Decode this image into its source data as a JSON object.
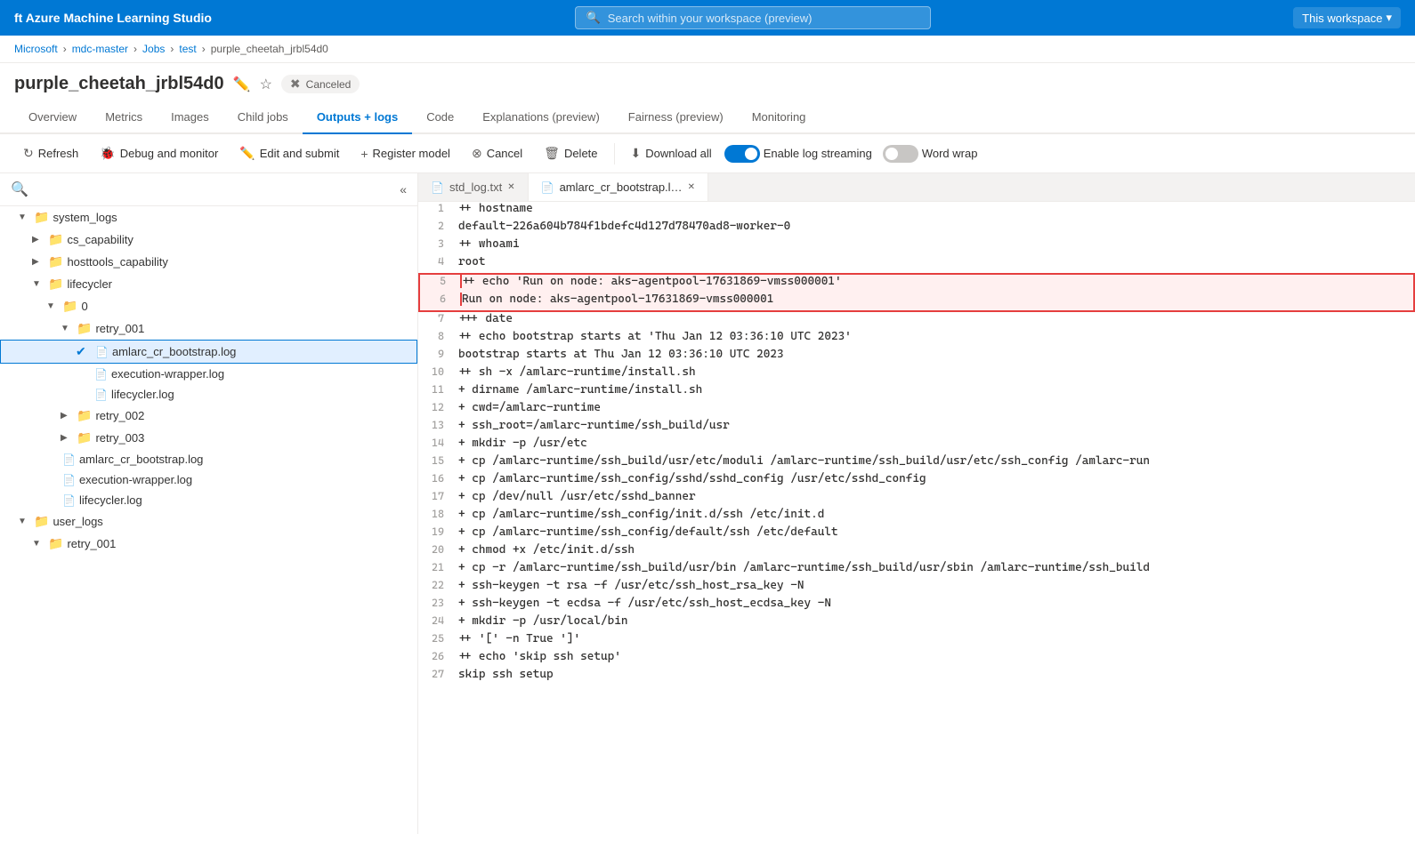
{
  "app": {
    "title": "ft Azure Machine Learning Studio"
  },
  "topbar": {
    "title": "ft Azure Machine Learning Studio",
    "search_placeholder": "Search within your workspace (preview)",
    "workspace_label": "This workspace"
  },
  "breadcrumb": {
    "items": [
      "Microsoft",
      "mdc-master",
      "Jobs",
      "test",
      "purple_cheetah_jrbl54d0"
    ]
  },
  "page": {
    "title": "purple_cheetah_jrbl54d0",
    "status": "Canceled"
  },
  "tabs": [
    {
      "label": "Overview"
    },
    {
      "label": "Metrics"
    },
    {
      "label": "Images"
    },
    {
      "label": "Child jobs"
    },
    {
      "label": "Outputs + logs",
      "active": true
    },
    {
      "label": "Code"
    },
    {
      "label": "Explanations (preview)"
    },
    {
      "label": "Fairness (preview)"
    },
    {
      "label": "Monitoring"
    }
  ],
  "toolbar": {
    "refresh": "Refresh",
    "debug": "Debug and monitor",
    "edit": "Edit and submit",
    "register": "Register model",
    "cancel": "Cancel",
    "delete": "Delete",
    "download": "Download all",
    "enable_log_streaming": "Enable log streaming",
    "word_wrap": "Word wrap"
  },
  "file_tree": {
    "items": [
      {
        "level": 1,
        "type": "folder",
        "name": "system_logs",
        "expanded": true,
        "chevron": "▼"
      },
      {
        "level": 2,
        "type": "folder",
        "name": "cs_capability",
        "expanded": false,
        "chevron": "▶"
      },
      {
        "level": 2,
        "type": "folder",
        "name": "hosttools_capability",
        "expanded": false,
        "chevron": "▶"
      },
      {
        "level": 2,
        "type": "folder",
        "name": "lifecycler",
        "expanded": true,
        "chevron": "▼"
      },
      {
        "level": 3,
        "type": "folder",
        "name": "0",
        "expanded": true,
        "chevron": "▼"
      },
      {
        "level": 4,
        "type": "folder",
        "name": "retry_001",
        "expanded": true,
        "chevron": "▼"
      },
      {
        "level": 5,
        "type": "file",
        "name": "amlarc_cr_bootstrap.log",
        "selected": true,
        "checked": true
      },
      {
        "level": 5,
        "type": "file",
        "name": "execution-wrapper.log"
      },
      {
        "level": 5,
        "type": "file",
        "name": "lifecycler.log"
      },
      {
        "level": 4,
        "type": "folder",
        "name": "retry_002",
        "expanded": false,
        "chevron": "▶"
      },
      {
        "level": 4,
        "type": "folder",
        "name": "retry_003",
        "expanded": false,
        "chevron": "▶"
      },
      {
        "level": 3,
        "type": "file",
        "name": "amlarc_cr_bootstrap.log"
      },
      {
        "level": 3,
        "type": "file",
        "name": "execution-wrapper.log"
      },
      {
        "level": 3,
        "type": "file",
        "name": "lifecycler.log"
      },
      {
        "level": 2,
        "type": "folder",
        "name": "user_logs",
        "expanded": true,
        "chevron": "▼"
      },
      {
        "level": 2,
        "type": "folder",
        "name": "retry_001",
        "expanded": true,
        "chevron": "▼"
      }
    ]
  },
  "code_tabs": [
    {
      "name": "std_log.txt",
      "active": false
    },
    {
      "name": "amlarc_cr_bootstrap.l…",
      "active": true
    }
  ],
  "code_lines": [
    {
      "num": 1,
      "content": "++ hostname"
    },
    {
      "num": 2,
      "content": "default-226a604b784f1bdefc4d127d78470ad8-worker-0"
    },
    {
      "num": 3,
      "content": "++ whoami"
    },
    {
      "num": 4,
      "content": "root"
    },
    {
      "num": 5,
      "content": "++ echo 'Run on node: aks-agentpool-17631869-vmss000001'",
      "highlight": true
    },
    {
      "num": 6,
      "content": "Run on node: aks-agentpool-17631869-vmss000001",
      "highlight": true
    },
    {
      "num": 7,
      "content": "+++ date"
    },
    {
      "num": 8,
      "content": "++ echo bootstrap starts at 'Thu Jan 12 03:36:10 UTC 2023'"
    },
    {
      "num": 9,
      "content": "bootstrap starts at Thu Jan 12 03:36:10 UTC 2023"
    },
    {
      "num": 10,
      "content": "++ sh -x /amlarc-runtime/install.sh"
    },
    {
      "num": 11,
      "content": "+ dirname /amlarc-runtime/install.sh"
    },
    {
      "num": 12,
      "content": "+ cwd=/amlarc-runtime"
    },
    {
      "num": 13,
      "content": "+ ssh_root=/amlarc-runtime/ssh_build/usr"
    },
    {
      "num": 14,
      "content": "+ mkdir -p /usr/etc"
    },
    {
      "num": 15,
      "content": "+ cp /amlarc-runtime/ssh_build/usr/etc/moduli /amlarc-runtime/ssh_build/usr/etc/ssh_config /amlarc-run"
    },
    {
      "num": 16,
      "content": "+ cp /amlarc-runtime/ssh_config/sshd/sshd_config /usr/etc/sshd_config"
    },
    {
      "num": 17,
      "content": "+ cp /dev/null /usr/etc/sshd_banner"
    },
    {
      "num": 18,
      "content": "+ cp /amlarc-runtime/ssh_config/init.d/ssh /etc/init.d"
    },
    {
      "num": 19,
      "content": "+ cp /amlarc-runtime/ssh_config/default/ssh /etc/default"
    },
    {
      "num": 20,
      "content": "+ chmod +x /etc/init.d/ssh"
    },
    {
      "num": 21,
      "content": "+ cp -r /amlarc-runtime/ssh_build/usr/bin /amlarc-runtime/ssh_build/usr/sbin /amlarc-runtime/ssh_build"
    },
    {
      "num": 22,
      "content": "+ ssh-keygen -t rsa -f /usr/etc/ssh_host_rsa_key -N"
    },
    {
      "num": 23,
      "content": "+ ssh-keygen -t ecdsa -f /usr/etc/ssh_host_ecdsa_key -N"
    },
    {
      "num": 24,
      "content": "+ mkdir -p /usr/local/bin"
    },
    {
      "num": 25,
      "content": "++ '[' -n True ']'"
    },
    {
      "num": 26,
      "content": "++ echo 'skip ssh setup'"
    },
    {
      "num": 27,
      "content": "skip ssh setup"
    }
  ]
}
